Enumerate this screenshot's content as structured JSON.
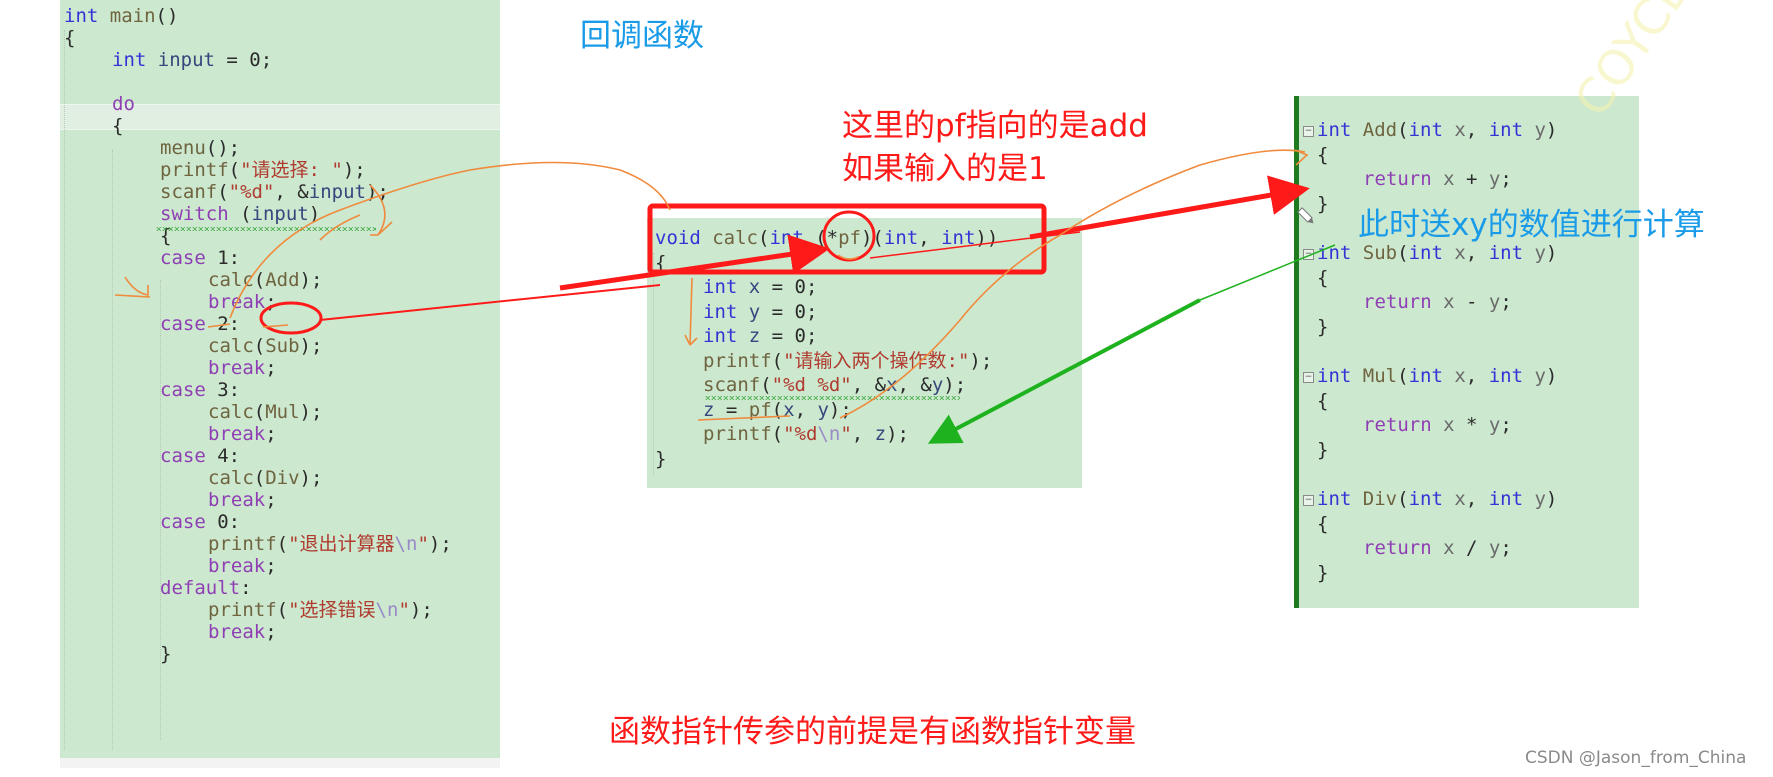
{
  "colors": {
    "code_bg": "#cce8cf",
    "annotation_red": "#ff1a1a",
    "annotation_blue": "#1a9be8",
    "arrow_green": "#1fb21f",
    "pen_orange": "#f08a3c",
    "watermark_gray": "#8a8a8a"
  },
  "titles": {
    "callback": "回调函数",
    "pf_note_line1": "这里的pf指向的是add",
    "pf_note_line2": "如果输入的是1",
    "send_xy_note": "此时送xy的数值进行计算",
    "bottom_note": "函数指针传参的前提是有函数指针变量"
  },
  "watermark": "CSDN @Jason_from_China",
  "main_panel": {
    "lines": [
      {
        "text": "int main()",
        "indent": 0
      },
      {
        "text": "{",
        "indent": 0
      },
      {
        "text": "int input = 0;",
        "indent": 1
      },
      {
        "text": "",
        "indent": 0
      },
      {
        "text": "do",
        "indent": 1
      },
      {
        "text": "{",
        "indent": 1
      },
      {
        "text": "menu();",
        "indent": 2
      },
      {
        "text": "printf(\"请选择: \");",
        "indent": 2
      },
      {
        "text": "scanf(\"%d\", &input);",
        "indent": 2
      },
      {
        "text": "switch (input)",
        "indent": 2
      },
      {
        "text": "{",
        "indent": 2
      },
      {
        "text": "case 1:",
        "indent": 2
      },
      {
        "text": "calc(Add);",
        "indent": 3
      },
      {
        "text": "break;",
        "indent": 3
      },
      {
        "text": "case 2:",
        "indent": 2
      },
      {
        "text": "calc(Sub);",
        "indent": 3
      },
      {
        "text": "break;",
        "indent": 3
      },
      {
        "text": "case 3:",
        "indent": 2
      },
      {
        "text": "calc(Mul);",
        "indent": 3
      },
      {
        "text": "break;",
        "indent": 3
      },
      {
        "text": "case 4:",
        "indent": 2
      },
      {
        "text": "calc(Div);",
        "indent": 3
      },
      {
        "text": "break;",
        "indent": 3
      },
      {
        "text": "case 0:",
        "indent": 2
      },
      {
        "text": "printf(\"退出计算器\\n\");",
        "indent": 3
      },
      {
        "text": "break;",
        "indent": 3
      },
      {
        "text": "default:",
        "indent": 2
      },
      {
        "text": "printf(\"选择错误\\n\");",
        "indent": 3
      },
      {
        "text": "break;",
        "indent": 3
      },
      {
        "text": "}",
        "indent": 2
      }
    ]
  },
  "calc_panel": {
    "lines": [
      {
        "text": "void calc(int (*pf)(int, int))",
        "indent": 0
      },
      {
        "text": "{",
        "indent": 0
      },
      {
        "text": "int x = 0;",
        "indent": 1
      },
      {
        "text": "int y = 0;",
        "indent": 1
      },
      {
        "text": "int z = 0;",
        "indent": 1
      },
      {
        "text": "printf(\"请输入两个操作数:\");",
        "indent": 1
      },
      {
        "text": "scanf(\"%d %d\", &x, &y);",
        "indent": 1
      },
      {
        "text": "z = pf(x, y);",
        "indent": 1
      },
      {
        "text": "printf(\"%d\\n\", z);",
        "indent": 1
      },
      {
        "text": "}",
        "indent": 0
      }
    ]
  },
  "ops_panel": {
    "functions": [
      {
        "signature": "int Add(int x, int y)",
        "open": "{",
        "body": "return x + y;",
        "close": "}"
      },
      {
        "signature": "int Sub(int x, int y)",
        "open": "{",
        "body": "return x - y;",
        "close": "}"
      },
      {
        "signature": "int Mul(int x, int y)",
        "open": "{",
        "body": "return x * y;",
        "close": "}"
      },
      {
        "signature": "int Div(int x, int y)",
        "open": "{",
        "body": "return x / y;",
        "close": "}"
      }
    ]
  }
}
